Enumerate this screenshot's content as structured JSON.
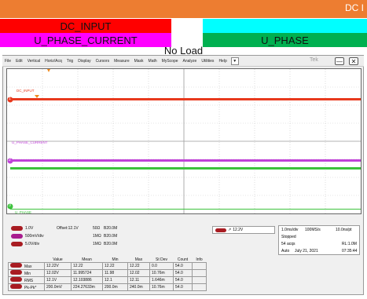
{
  "colors": {
    "banner_orange": "#ED7D31",
    "dc_input_red": "#FF0000",
    "current_magenta": "#FF00FF",
    "phase_green": "#00B050",
    "phase_cyan": "#00FFFF",
    "ch1_trace": "#e8391d",
    "ch2_trace": "#c042d8",
    "ch3_trace": "#3cc23c",
    "trigger_orange": "#f08a1e"
  },
  "header": {
    "top_banner_text": "DC I",
    "dc_input_label": "DC_INPUT",
    "current_label": "U_PHASE_CURRENT",
    "phase_label": "U_PHASE",
    "load_title": "No Load"
  },
  "menu": {
    "items": [
      "File",
      "Edit",
      "Vertical",
      "Horiz/Acq",
      "Trig",
      "Display",
      "Cursors",
      "Measure",
      "Mask",
      "Math",
      "MyScope",
      "Analyze",
      "Utilities",
      "Help"
    ],
    "dropdown_icon": "chevron-down-icon",
    "brand": "Tek",
    "minimize_icon": "minimize-icon",
    "close_icon": "close-icon"
  },
  "waveform": {
    "trace1_label": "DC_INPUT",
    "trace2_label": "U_PHASE_CURRENT",
    "trace3_label": "U_PHASE",
    "ch1_marker": "1",
    "ch2_marker": "2",
    "ch3_marker": "3"
  },
  "channels": [
    {
      "scale": "1.0V",
      "offset": "Offset:12.1V",
      "impedance": "50Ω",
      "bw": "B",
      "bw_value": "20.0M"
    },
    {
      "scale": "500mV/div",
      "offset": "",
      "impedance": "1MΩ",
      "bw": "B",
      "bw_value": "20.0M"
    },
    {
      "scale": "5.0V/div",
      "offset": "",
      "impedance": "1MΩ",
      "bw": "B",
      "bw_value": "20.0M"
    }
  ],
  "trigger": {
    "level": "12.2V"
  },
  "acquisition": {
    "timebase": "1.0ms/div",
    "sample_rate": "100MS/s",
    "resolution": "10.0ns/pt",
    "state": "Stopped",
    "acqs": "54 acqs",
    "record_length": "RL:1.0M",
    "mode": "Auto",
    "date": "July 21, 2021",
    "time": "07:35:44"
  },
  "measurements": {
    "headers": [
      "",
      "Value",
      "Mean",
      "Min",
      "Max",
      "St Dev",
      "Count",
      "Info"
    ],
    "rows": [
      {
        "name": "Max",
        "values": [
          "12.22V",
          "12.22",
          "12.22",
          "12.22",
          "0.0",
          "54.0",
          ""
        ]
      },
      {
        "name": "Min",
        "values": [
          "12.02V",
          "11.995724",
          "11.98",
          "12.02",
          "10.76m",
          "54.0",
          ""
        ]
      },
      {
        "name": "RMS",
        "values": [
          "12.1V",
          "12.103886",
          "12.1",
          "12.11",
          "1.646m",
          "54.0",
          ""
        ]
      },
      {
        "name": "Pk-Pk*",
        "values": [
          "200.0mV",
          "224.27633m",
          "200.0m",
          "240.0m",
          "10.76m",
          "54.0",
          ""
        ]
      }
    ]
  }
}
